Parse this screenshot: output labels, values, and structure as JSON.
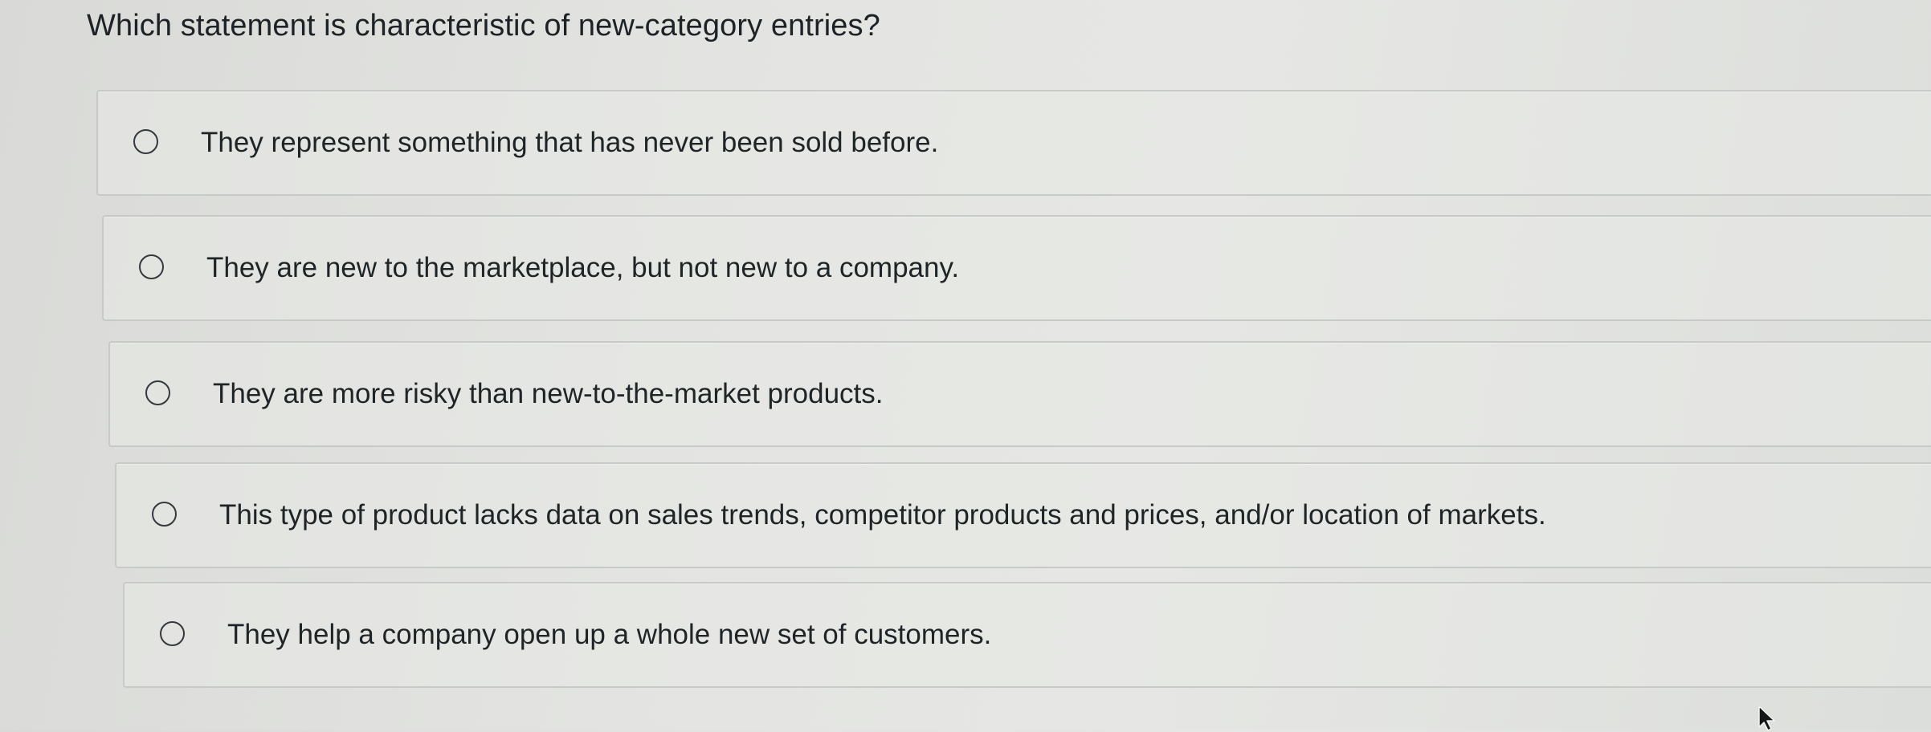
{
  "question": {
    "text": "Which statement is characteristic of new-category entries?"
  },
  "options": [
    {
      "label": "They represent something that has never been sold before.",
      "selected": false
    },
    {
      "label": "They are new to the marketplace, but not new to a company.",
      "selected": false
    },
    {
      "label": "They are more risky than new-to-the-market products.",
      "selected": false
    },
    {
      "label": "This type of product lacks data on sales trends, competitor products and prices, and/or location of markets.",
      "selected": false
    },
    {
      "label": "They help a company open up a whole new set of customers.",
      "selected": false
    }
  ],
  "icons": {
    "radio": "radio-unchecked-icon",
    "cursor": "mouse-pointer-icon"
  }
}
